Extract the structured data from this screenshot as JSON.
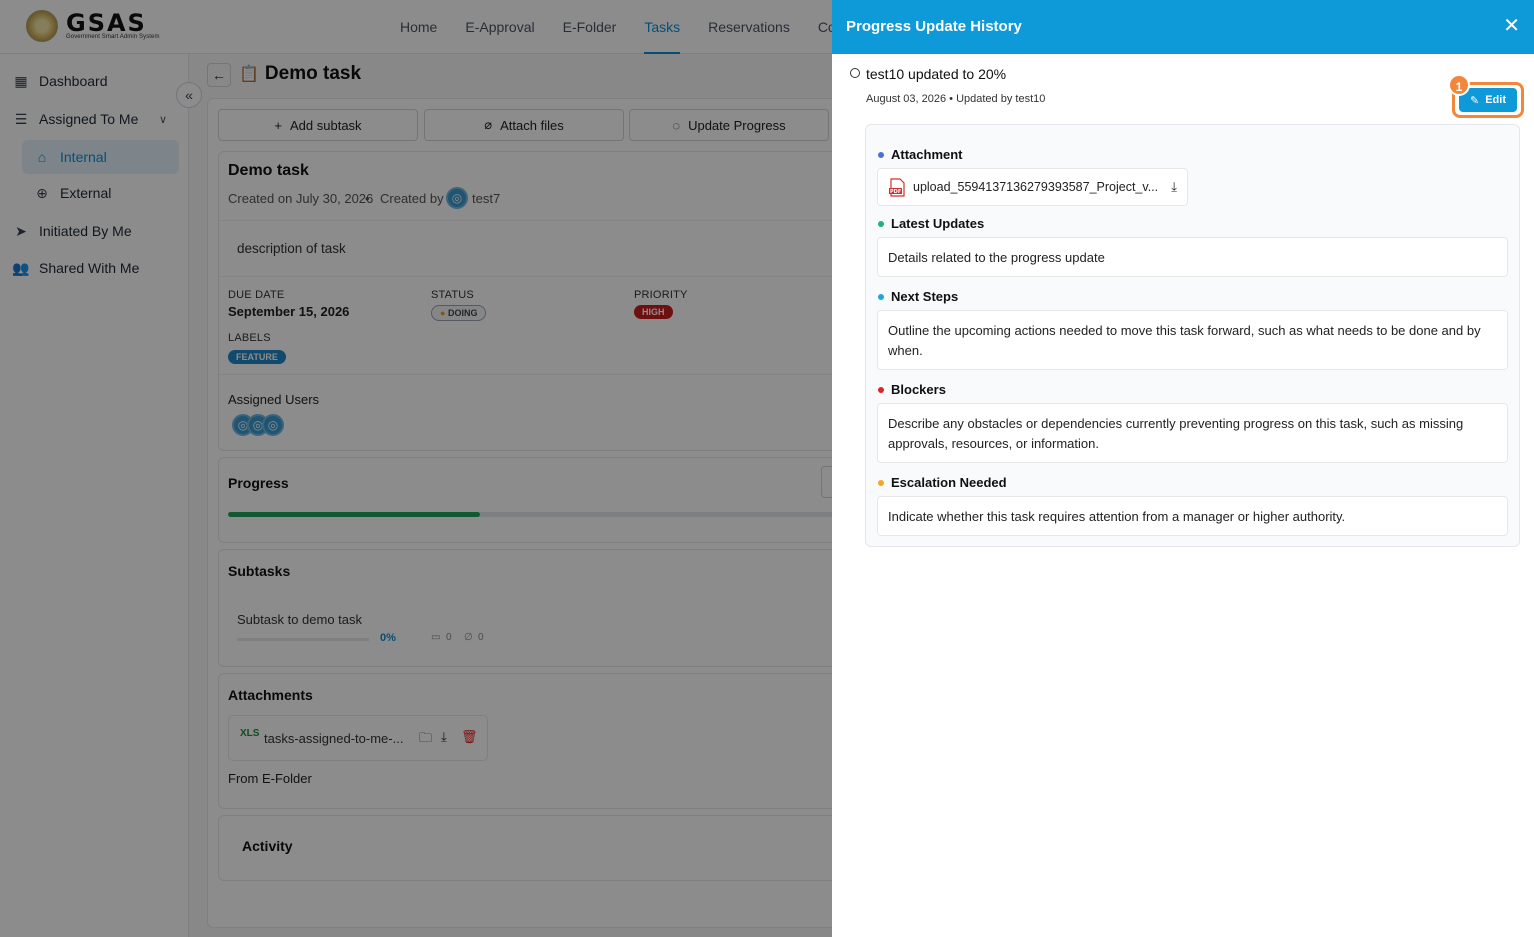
{
  "header": {
    "logo_title": "GSAS",
    "logo_subtitle": "Government Smart Admin System",
    "nav": [
      {
        "label": "Home"
      },
      {
        "label": "E-Approval"
      },
      {
        "label": "E-Folder"
      },
      {
        "label": "Tasks",
        "active": true
      },
      {
        "label": "Reservations"
      },
      {
        "label": "Con"
      }
    ]
  },
  "sidebar": {
    "items": [
      {
        "label": "Dashboard",
        "icon": "grid-icon"
      },
      {
        "label": "Assigned To Me",
        "icon": "list-icon"
      },
      {
        "label": "Internal",
        "icon": "building-icon",
        "active": true
      },
      {
        "label": "External",
        "icon": "globe-icon"
      },
      {
        "label": "Initiated By Me",
        "icon": "send-icon"
      },
      {
        "label": "Shared With Me",
        "icon": "users-icon"
      }
    ]
  },
  "task": {
    "page_title": "Demo task",
    "actions": {
      "add_subtask": "Add subtask",
      "attach_files": "Attach files",
      "update_progress": "Update Progress"
    },
    "name": "Demo task",
    "created_on": "Created on July 30, 2026",
    "created_by_label": "Created by",
    "created_by": "test7",
    "description": "description of task",
    "due_date_label": "DUE DATE",
    "due_date": "September 15, 2026",
    "status_label": "STATUS",
    "status": "DOING",
    "priority_label": "PRIORITY",
    "priority": "HIGH",
    "labels_label": "LABELS",
    "label": "FEATURE",
    "assigned_users_label": "Assigned Users",
    "progress_label": "Progress",
    "progress_fraction": 0.2,
    "subtasks_label": "Subtasks",
    "subtask": {
      "name": "Subtask to demo task",
      "percent": "0%",
      "comments": "0",
      "attachments": "0"
    },
    "attachments_label": "Attachments",
    "attachment_file": "tasks-assigned-to-me-...",
    "from_efolder": "From E-Folder",
    "activity_label": "Activity"
  },
  "drawer": {
    "title": "Progress Update History",
    "update_title": "test10 updated to 20%",
    "update_meta": "August 03, 2026 • Updated by test10",
    "edit_label": "Edit",
    "annotation_number": "1",
    "sections": {
      "attachment_label": "Attachment",
      "attachment_file": "upload_5594137136279393587_Project_v...",
      "latest_updates_label": "Latest Updates",
      "latest_updates": "Details related to the progress update",
      "next_steps_label": "Next Steps",
      "next_steps": "Outline the upcoming actions needed to move this task forward, such as what needs to be done and by when.",
      "blockers_label": "Blockers",
      "blockers": "Describe any obstacles or dependencies currently preventing progress on this task, such as missing approvals, resources, or information.",
      "escalation_label": "Escalation Needed",
      "escalation": "Indicate whether this task requires attention from a manager or higher authority."
    }
  },
  "colors": {
    "accent": "#0e9ad8",
    "highlight": "#f2873b",
    "dot_attachment": "#4f6fd8",
    "dot_latest": "#22b07d",
    "dot_next": "#1ea7dc",
    "dot_blockers": "#dc2626",
    "dot_escalation": "#f5a623"
  }
}
